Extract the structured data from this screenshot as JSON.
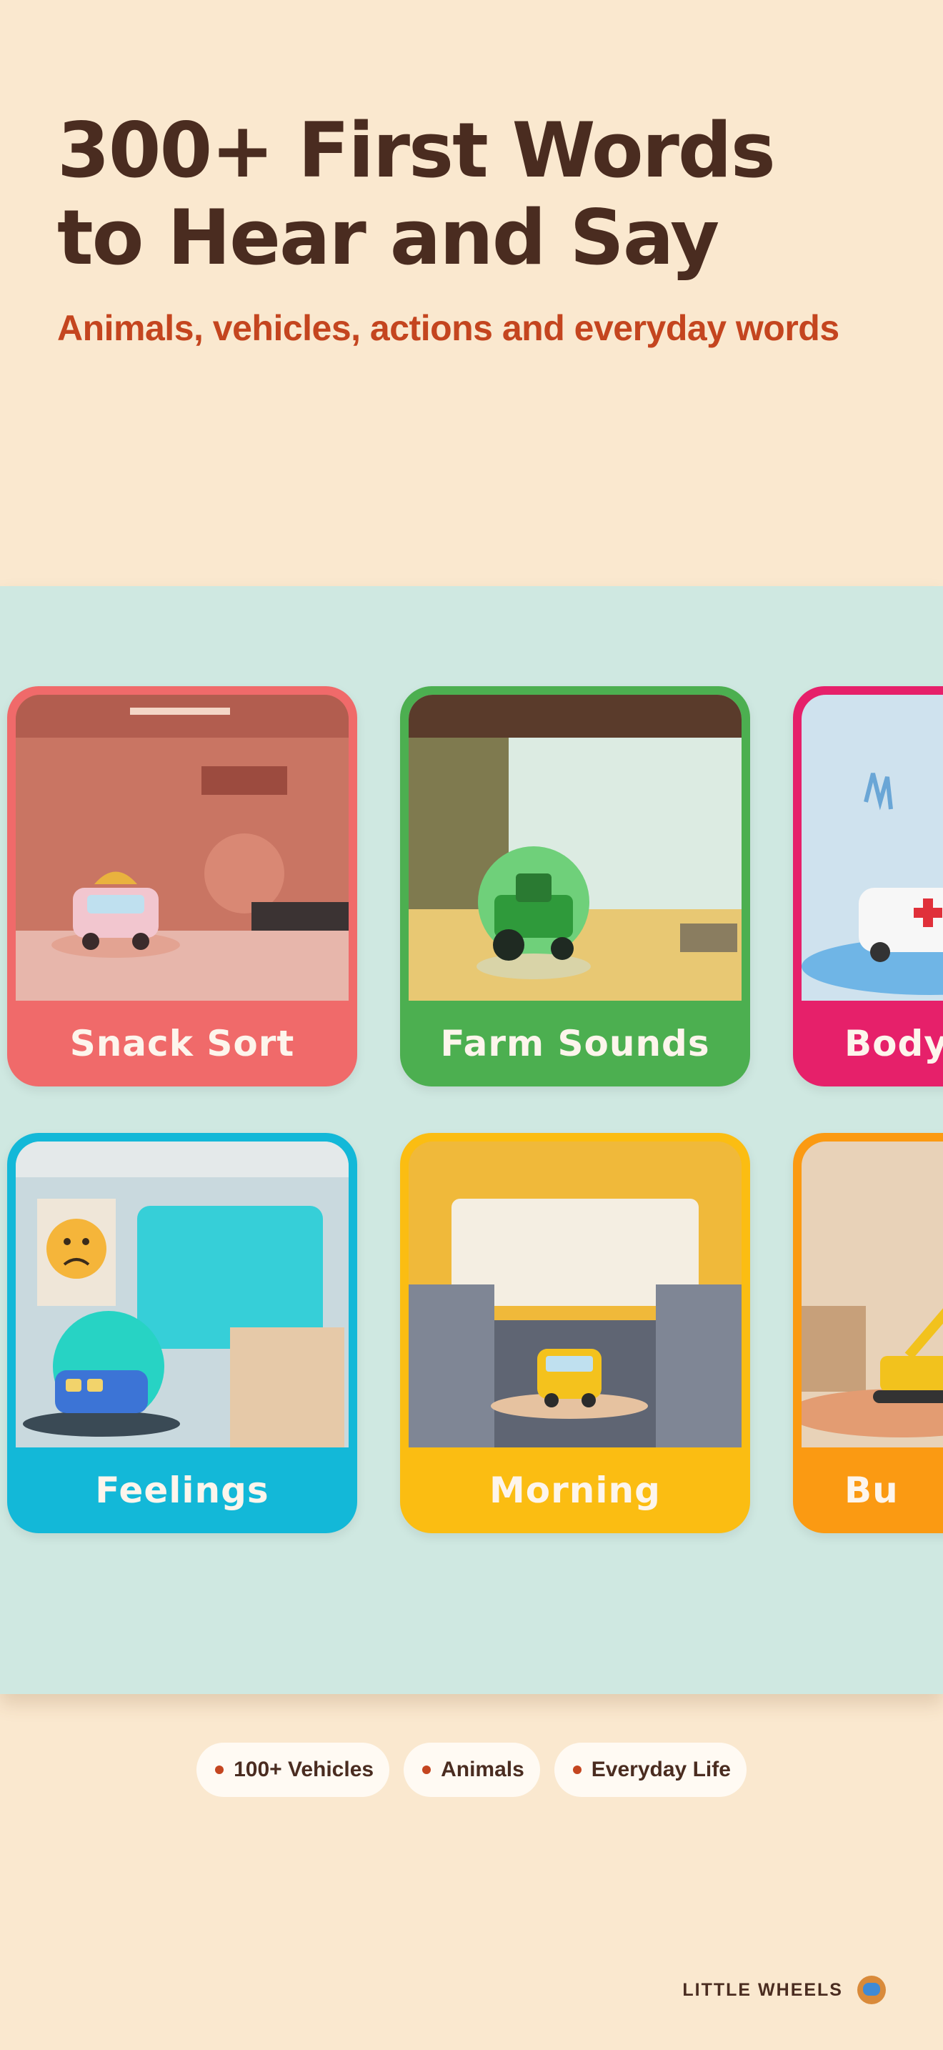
{
  "hero": {
    "title_line1": "300+ First Words",
    "title_line2": "to Hear and Say",
    "subtitle": "Animals, vehicles, actions and everyday words"
  },
  "cards": [
    {
      "label": "Snack Sort",
      "color": "#f06a6a",
      "icon": "food-truck-icon"
    },
    {
      "label": "Farm Sounds",
      "color": "#4caf50",
      "icon": "tractor-icon"
    },
    {
      "label": "Body",
      "color": "#e6206a",
      "icon": "ambulance-icon"
    },
    {
      "label": "Feelings",
      "color": "#13b8d8",
      "icon": "train-icon"
    },
    {
      "label": "Morning",
      "color": "#fbbd12",
      "icon": "school-bus-icon"
    },
    {
      "label": "Bu",
      "color": "#fb9a12",
      "icon": "excavator-icon"
    }
  ],
  "chips": [
    {
      "label": "100+ Vehicles"
    },
    {
      "label": "Animals"
    },
    {
      "label": "Everyday Life"
    }
  ],
  "brand": {
    "name": "LITTLE WHEELS",
    "logo_icon": "truck-logo-icon"
  },
  "colors": {
    "background": "#fae8cf",
    "panel": "#cfe8e1",
    "title": "#4a2c20",
    "accent": "#c4451f"
  }
}
